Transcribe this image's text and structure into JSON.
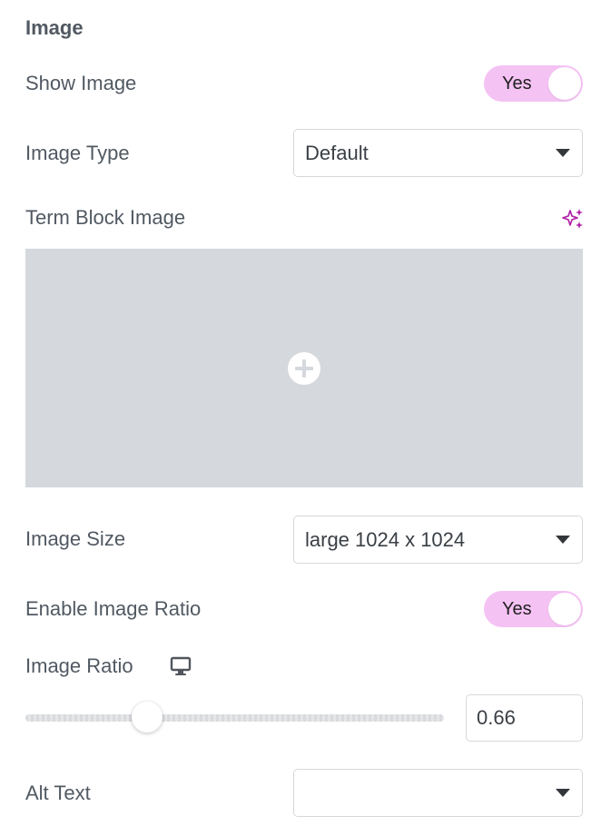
{
  "section": {
    "title": "Image"
  },
  "show_image": {
    "label": "Show Image",
    "toggle_text": "Yes",
    "on": true
  },
  "image_type": {
    "label": "Image Type",
    "value": "Default"
  },
  "term_block_image": {
    "label": "Term Block Image",
    "ai_icon": "sparkle-icon",
    "add_icon": "plus-circle-icon"
  },
  "image_size": {
    "label": "Image Size",
    "value": "large 1024 x 1024"
  },
  "enable_ratio": {
    "label": "Enable Image Ratio",
    "toggle_text": "Yes",
    "on": true
  },
  "image_ratio": {
    "label": "Image Ratio",
    "device_icon": "desktop-icon",
    "value": "0.66",
    "slider_fraction": 0.29
  },
  "alt_text": {
    "label": "Alt Text",
    "value": ""
  },
  "colors": {
    "toggle_on": "#f5c2f4",
    "ai_accent": "#b01ba5",
    "media_bg": "#d5d8dc",
    "label": "#515962"
  }
}
